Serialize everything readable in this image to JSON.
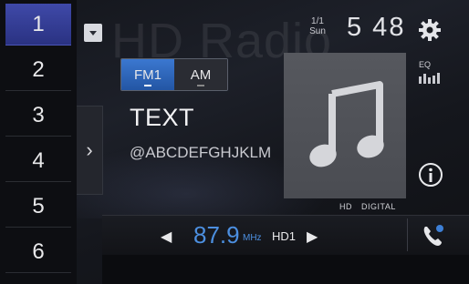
{
  "presets": [
    {
      "label": "1",
      "active": true
    },
    {
      "label": "2",
      "active": false
    },
    {
      "label": "3",
      "active": false
    },
    {
      "label": "4",
      "active": false
    },
    {
      "label": "5",
      "active": false
    },
    {
      "label": "6",
      "active": false
    }
  ],
  "watermark": "HD Radio",
  "side_arrow": "›",
  "bands": [
    {
      "label": "FM1",
      "active": true
    },
    {
      "label": "AM",
      "active": false
    }
  ],
  "now_playing": {
    "title": "TEXT",
    "artist": "@ABCDEFGHJKLM"
  },
  "status": {
    "date_top": "1/1",
    "date_bottom": "Sun",
    "clock": "5 48"
  },
  "eq_label": "EQ",
  "art_badges": {
    "hd": "HD",
    "digital": "DIGITAL"
  },
  "tuner": {
    "prev_arrow": "◀",
    "frequency": "87.9",
    "unit": "MHz",
    "channel": "HD1",
    "next_arrow": "▶"
  },
  "icons": {
    "settings": "gear-icon",
    "eq": "eq-icon",
    "info": "info-icon",
    "phone": "phone-icon",
    "dropdown": "chevron-down-icon",
    "album_art": "music-note-icon"
  },
  "colors": {
    "accent_blue": "#4c8fe0",
    "preset_active": "#3f49a8",
    "band_active": "#3b78d0"
  }
}
